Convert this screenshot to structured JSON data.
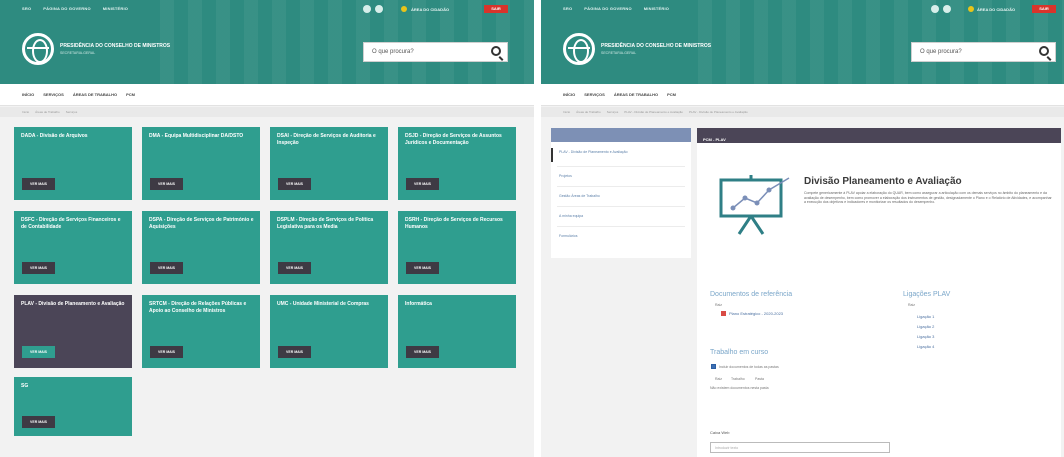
{
  "left": {
    "top_links": [
      "SRO",
      "PÁGINA DO GOVERNO",
      "MINISTÉRIO"
    ],
    "citizen_label": "ÁREA DO CIDADÃO",
    "red_tag": "SAIR",
    "org_name": "PRESIDÊNCIA DO CONSELHO DE MINISTROS",
    "org_sub": "SECRETARIA-GERAL",
    "search_placeholder": "O que procura?",
    "nav": [
      "INÍCIO",
      "SERVIÇOS",
      "ÁREAS DE TRABALHO",
      "PCM"
    ],
    "breadcrumb": [
      "Início",
      "Áreas de Trabalho",
      "Serviços"
    ],
    "view_more_label": "VER MAIS",
    "tiles": [
      {
        "title": "DADA - Divisão de Arquivos",
        "active": false
      },
      {
        "title": "DMA - Equipa Multidisciplinar DA/DSTO",
        "active": false
      },
      {
        "title": "DSAI - Direção de Serviços de Auditoria e Inspeção",
        "active": false
      },
      {
        "title": "DSJD - Direção de Serviços de Assuntos Jurídicos e Documentação",
        "active": false
      },
      {
        "title": "DSFC - Direção de Serviços Financeiros e de Contabilidade",
        "active": false
      },
      {
        "title": "DSPA - Direção de Serviços de Património e Aquisições",
        "active": false
      },
      {
        "title": "DSPLM - Direção de Serviços de Política Legislativa para os Media",
        "active": false
      },
      {
        "title": "DSRH - Direção de Serviços de Recursos Humanos",
        "active": false
      },
      {
        "title": "PLAV - Divisão de Planeamento e Avaliação",
        "active": true
      },
      {
        "title": "SRTCM - Direção de Relações Públicas e Apoio ao Conselho de Ministros",
        "active": false
      },
      {
        "title": "UMC - Unidade Ministerial de Compras",
        "active": false
      },
      {
        "title": "Informática",
        "active": false
      },
      {
        "title": "SG",
        "active": false
      }
    ]
  },
  "right": {
    "top_links": [
      "SRO",
      "PÁGINA DO GOVERNO",
      "MINISTÉRIO"
    ],
    "citizen_label": "ÁREA DO CIDADÃO",
    "red_tag": "SAIR",
    "org_name": "PRESIDÊNCIA DO CONSELHO DE MINISTROS",
    "org_sub": "SECRETARIA-GERAL",
    "search_placeholder": "O que procura?",
    "nav": [
      "INÍCIO",
      "SERVIÇOS",
      "ÁREAS DE TRABALHO",
      "PCM"
    ],
    "breadcrumb": [
      "Início",
      "Áreas de Trabalho",
      "Serviços",
      "PLAV - Divisão de Planeamento e Avaliação",
      "PLAV - Divisão de Planeamento e Avaliação"
    ],
    "sidebar_items": [
      "PLAV - Divisão de Planeamento e Avaliação",
      "Projetos",
      "Gestão Áreas de Trabalho",
      "A minha equipa",
      "Formulários"
    ],
    "content_header": "PCM - PLAV",
    "title": "Divisão Planeamento e Avaliação",
    "description": "Compete genericamente à PLAV apoiar a elaboração do QUAR, bem como assegurar a articulação com os demais serviços no âmbito do planeamento e da avaliação de desempenho, bem como promover a elaboração dos instrumentos de gestão, designadamente o Plano e o Relatório de Atividades, e acompanhar a execução dos objetivos e indicadores e monitorizar os resultados do desempenho.",
    "docs_label": "Documentos de referência",
    "docs_root": "Raiz",
    "doc_file": "Plano Estratégico - 2020-2023",
    "links_label": "Ligações PLAV",
    "links_root": "Raiz",
    "links": [
      "Ligação 1",
      "Ligação 2",
      "Ligação 3",
      "Ligação 4"
    ],
    "work_label": "Trabalho em curso",
    "work_checkbox": "Incluir documentos de todas as pastas",
    "work_path": [
      "Raiz",
      "Trabalho",
      "Pasta"
    ],
    "work_empty": "Não existem documentos nesta pasta",
    "field_label": "Caixa Web",
    "field_placeholder": "Introduzir texto"
  }
}
